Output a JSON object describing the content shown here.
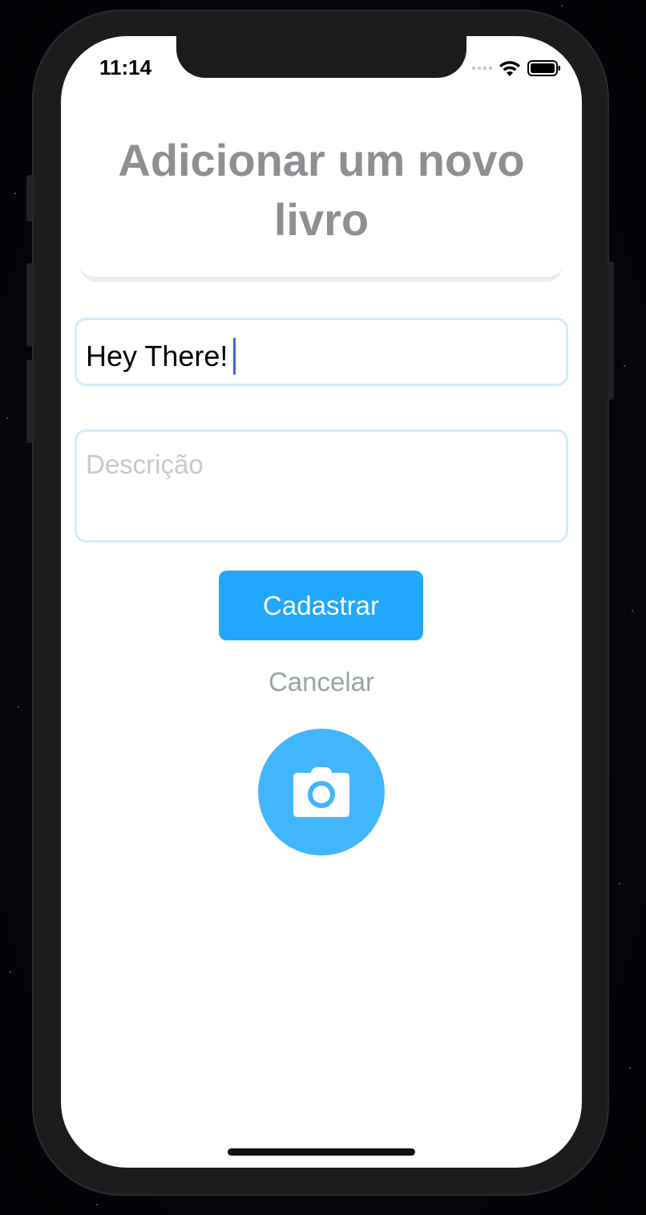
{
  "status_bar": {
    "time": "11:14"
  },
  "page": {
    "title": "Adicionar um novo livro"
  },
  "form": {
    "name_value": "Hey There!",
    "description_placeholder": "Descrição",
    "submit_label": "Cadastrar",
    "cancel_label": "Cancelar"
  },
  "icons": {
    "camera_button": "camera-icon",
    "status_wifi": "wifi-icon",
    "status_battery": "battery-icon",
    "status_signal": "signal-icon"
  },
  "colors": {
    "accent": "#21a7fc",
    "camera_button": "#41b6fd",
    "field_border": "#d3ebf8",
    "title_text": "#8e8e93",
    "cancel_text": "#95a5a6",
    "caret": "#3c67f0"
  }
}
